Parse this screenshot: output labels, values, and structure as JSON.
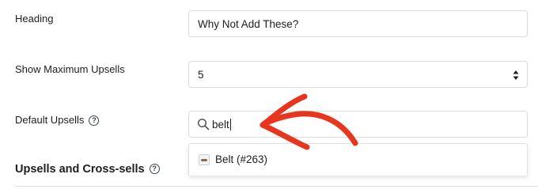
{
  "heading_row": {
    "label": "Heading",
    "value": "Why Not Add These?"
  },
  "max_upsells_row": {
    "label": "Show Maximum Upsells",
    "value": "5"
  },
  "default_upsells_row": {
    "label": "Default Upsells",
    "help": "?",
    "search_value": "belt"
  },
  "dropdown": {
    "options": [
      {
        "label": "Belt (#263)"
      }
    ]
  },
  "section": {
    "title": "Upsells and Cross-sells",
    "help": "?"
  },
  "annotation": {
    "arrow_color": "#e8361e"
  }
}
